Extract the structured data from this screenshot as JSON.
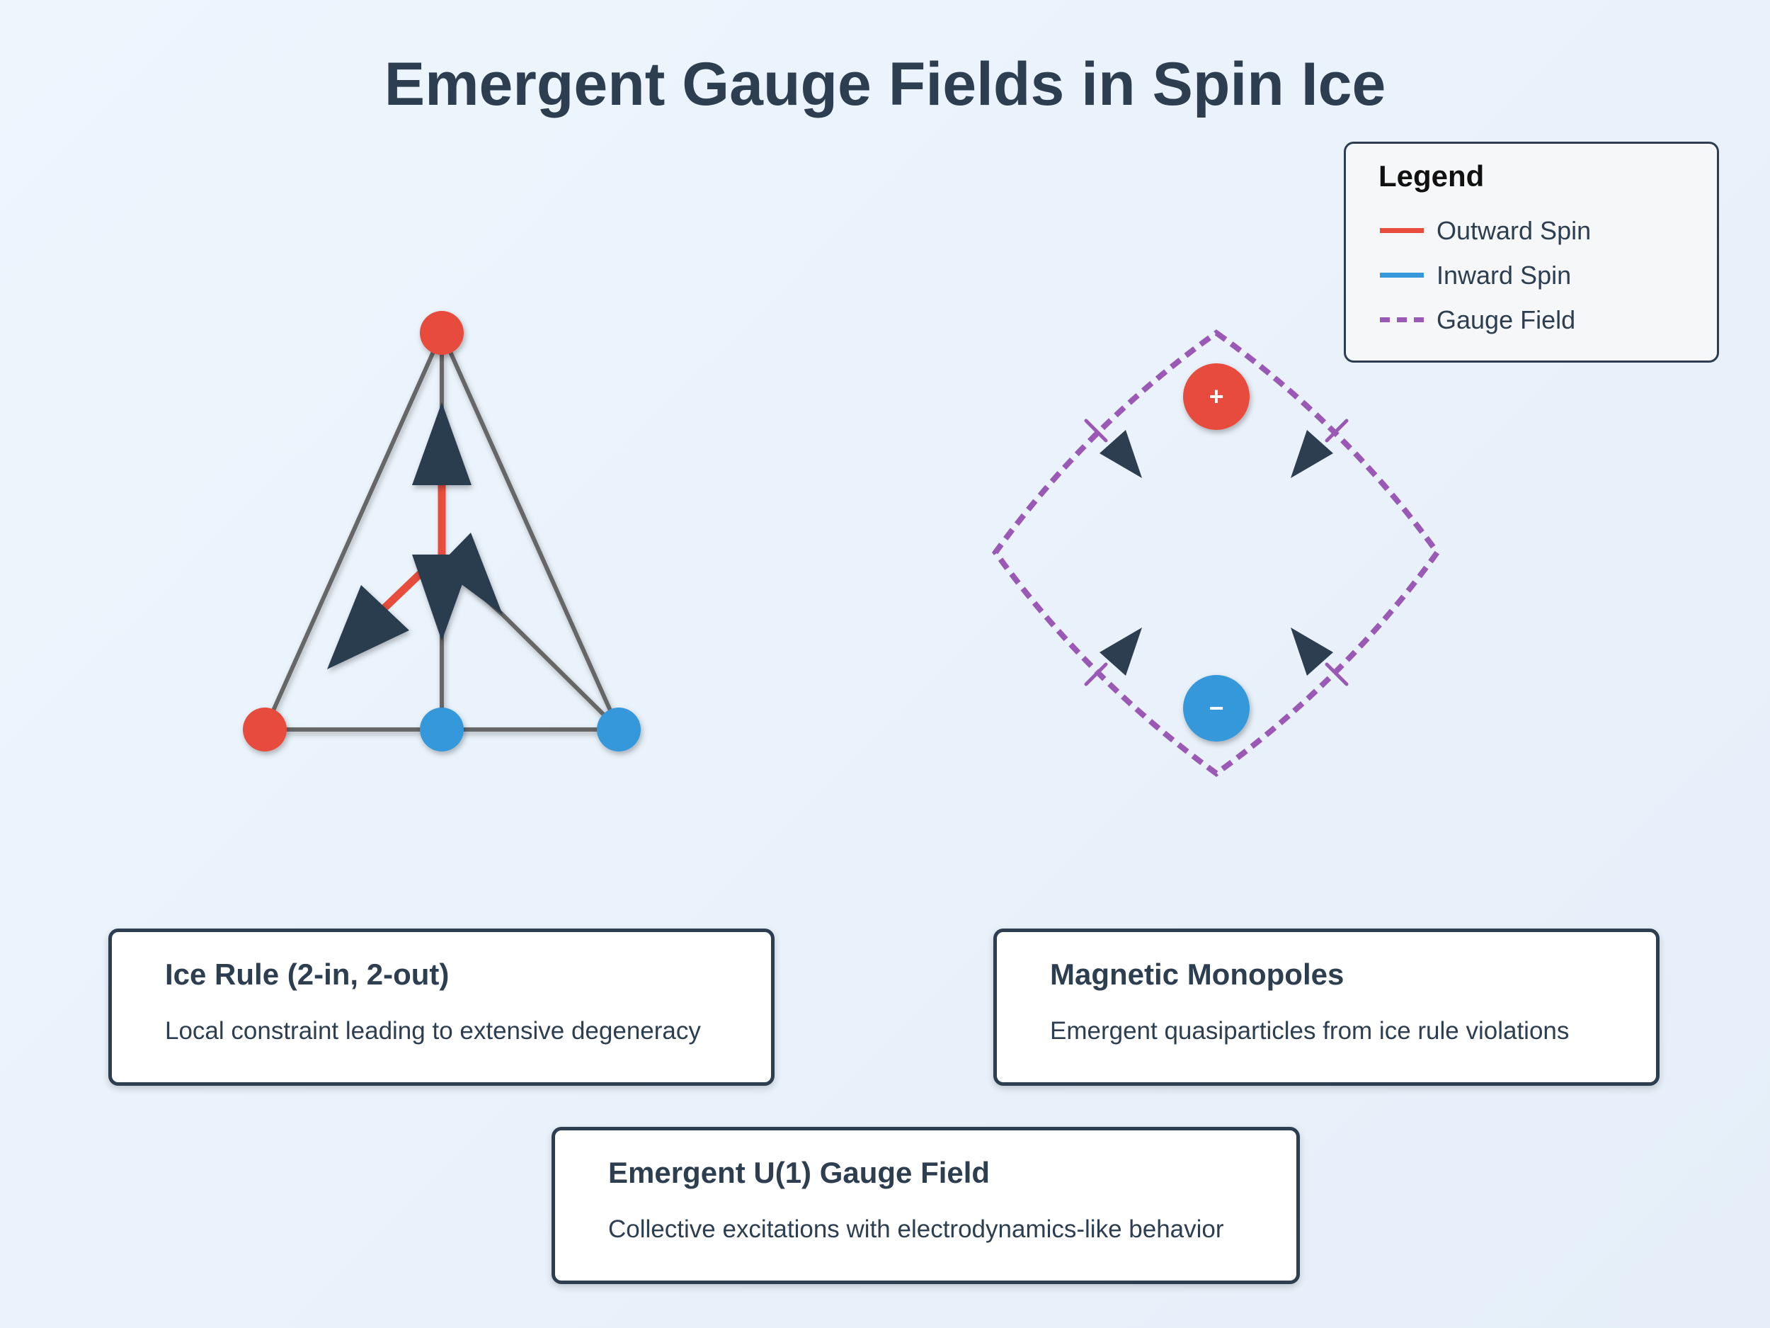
{
  "title": "Emergent Gauge Fields in Spin Ice",
  "colors": {
    "outward": "#e74c3c",
    "inward": "#3498db",
    "gauge": "#9b59b6",
    "arrow": "#2c3e50",
    "edge": "#666666",
    "text": "#2d3e50"
  },
  "legend": {
    "title": "Legend",
    "items": [
      {
        "label": "Outward Spin",
        "style": "solid",
        "color": "#e74c3c"
      },
      {
        "label": "Inward Spin",
        "style": "solid",
        "color": "#3498db"
      },
      {
        "label": "Gauge Field",
        "style": "dashed",
        "color": "#9b59b6"
      }
    ]
  },
  "tetrahedron": {
    "vertex_types": [
      "outward",
      "outward",
      "inward",
      "inward"
    ]
  },
  "monopoles": {
    "positive_symbol": "+",
    "negative_symbol": "−"
  },
  "cards": {
    "ice_rule": {
      "title": "Ice Rule (2-in, 2-out)",
      "description": "Local constraint leading to extensive degeneracy"
    },
    "monopoles": {
      "title": "Magnetic Monopoles",
      "description": "Emergent quasiparticles from ice rule violations"
    },
    "gauge_field": {
      "title": "Emergent U(1) Gauge Field",
      "description": "Collective excitations with electrodynamics-like behavior"
    }
  }
}
